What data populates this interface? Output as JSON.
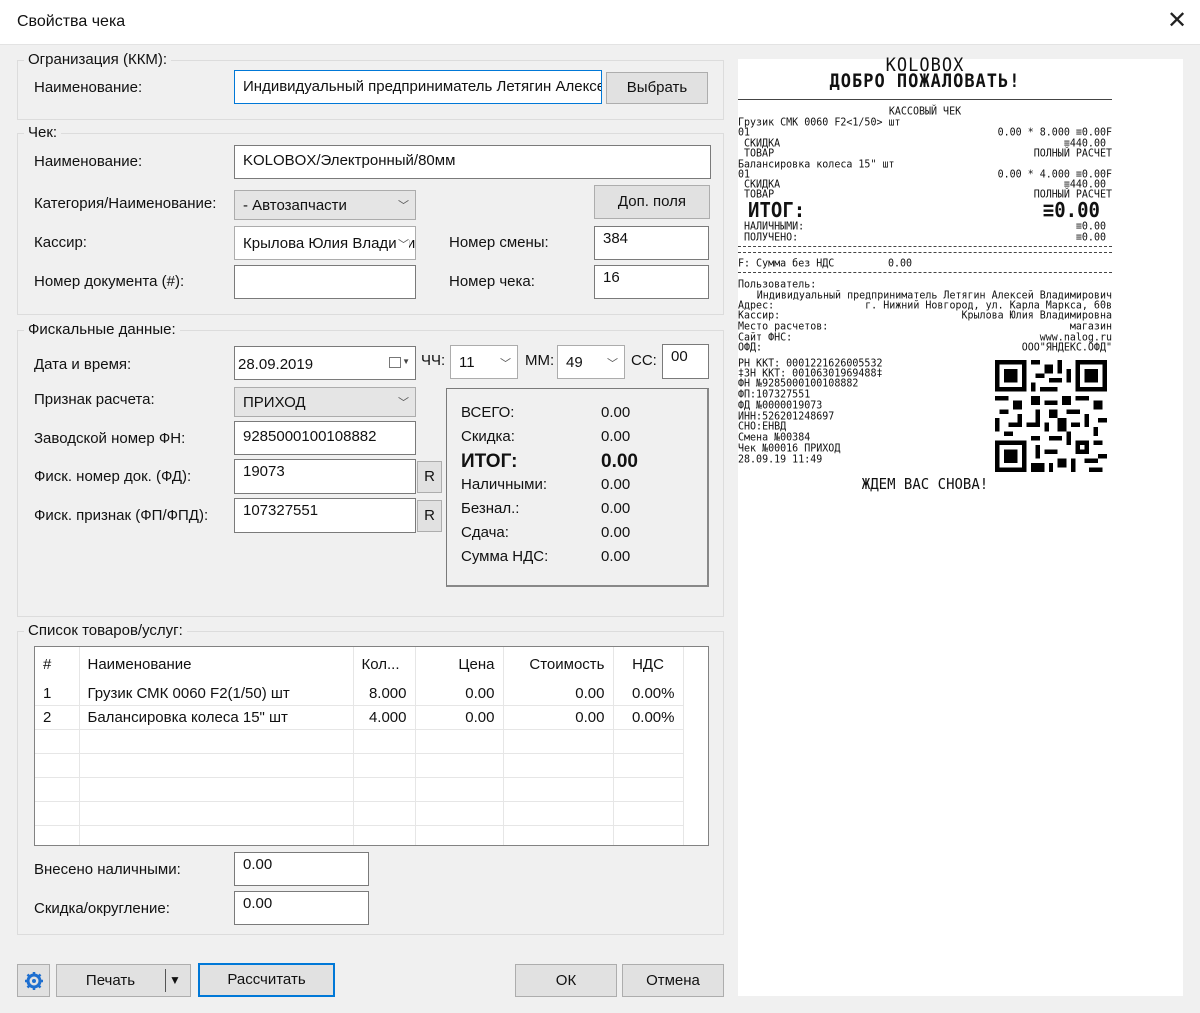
{
  "window": {
    "title": "Свойства чека",
    "close_glyph": "✕"
  },
  "org": {
    "legend": "Огранизация (ККМ):",
    "name_label": "Наименование:",
    "name_value": "Индивидуальный предприниматель Летягин Алексей Владимирович",
    "select_button": "Выбрать"
  },
  "check": {
    "legend": "Чек:",
    "name_label": "Наименование:",
    "name_value": "KOLOBOX/Электронный/80мм",
    "category_label": "Категория/Наименование:",
    "category_value": "- Автозапчасти",
    "extra_fields_button": "Доп. поля",
    "cashier_label": "Кассир:",
    "cashier_value": "Крылова Юлия Владимировна",
    "shift_label": "Номер смены:",
    "shift_value": "384",
    "doc_label": "Номер документа (#):",
    "doc_value": "",
    "check_no_label": "Номер чека:",
    "check_no_value": "16"
  },
  "fiscal": {
    "legend": "Фискальные данные:",
    "datetime_label": "Дата и время:",
    "date_value": "28.09.2019",
    "hh_label": "ЧЧ:",
    "hh_value": "11",
    "mm_label": "ММ:",
    "mm_value": "49",
    "ss_label": "СС:",
    "ss_value": "00",
    "calc_sign_label": "Признак расчета:",
    "calc_sign_value": "ПРИХОД",
    "fn_label": "Заводской номер ФН:",
    "fn_value": "9285000100108882",
    "fd_label": "Фиск. номер док. (ФД):",
    "fd_value": "19073",
    "fp_label": "Фиск. признак (ФП/ФПД):",
    "fp_value": "107327551",
    "r_button": "R"
  },
  "summary": {
    "total_label": "ВСЕГО:",
    "total_value": "0.00",
    "discount_label": "Скидка:",
    "discount_value": "0.00",
    "itog_label": "ИТОГ:",
    "itog_value": "0.00",
    "cash_label": "Наличными:",
    "cash_value": "0.00",
    "cashless_label": "Безнал.:",
    "cashless_value": "0.00",
    "change_label": "Сдача:",
    "change_value": "0.00",
    "vat_label": "Сумма НДС:",
    "vat_value": "0.00"
  },
  "goods": {
    "legend": "Список товаров/услуг:",
    "columns": [
      "#",
      "Наименование",
      "Кол...",
      "Цена",
      "Стоимость",
      "НДС"
    ],
    "rows": [
      [
        "1",
        "Грузик СМК 0060 F2(1/50) шт",
        "8.000",
        "0.00",
        "0.00",
        "0.00%"
      ],
      [
        "2",
        "Балансировка колеса 15\" шт",
        "4.000",
        "0.00",
        "0.00",
        "0.00%"
      ]
    ],
    "cash_in_label": "Внесено наличными:",
    "cash_in_value": "0.00",
    "rounding_label": "Скидка/округление:",
    "rounding_value": "0.00"
  },
  "footer": {
    "print_button": "Печать",
    "calculate_button": "Рассчитать",
    "ok_button": "ОК",
    "cancel_button": "Отмена"
  },
  "receipt": {
    "brand": "KOLOBOX",
    "welcome": "ДОБРО ПОЖАЛОВАТЬ!",
    "doc_type": "КАССОВЫЙ ЧЕК",
    "item1_name": "Грузик СМК 0060 F2<1/50> шт",
    "item1_code": "01",
    "item1_calc": "0.00 * 8.000 ≡0.00F",
    "item1_discount_label": "СКИДКА",
    "item1_discount_value": "≡440.00",
    "item1_type": "ТОВАР",
    "item1_mode": "ПОЛНЫЙ РАСЧЕТ",
    "item2_name": "Балансировка колеса 15\" шт",
    "item2_code": "01",
    "item2_calc": "0.00 * 4.000 ≡0.00F",
    "item2_discount_label": "СКИДКА",
    "item2_discount_value": "≡440.00",
    "item2_type": "ТОВАР",
    "item2_mode": "ПОЛНЫЙ РАСЧЕТ",
    "itog_label": "ИТОГ:",
    "itog_value": "≡0.00",
    "cash_label": "НАЛИЧНЫМИ:",
    "cash_value": "≡0.00",
    "received_label": "ПОЛУЧЕНО:",
    "received_value": "≡0.00",
    "vat_line_label": "F: Сумма без НДС",
    "vat_line_value": "0.00",
    "user_label": "Пользователь:",
    "user_value": "Индивидуальный предприниматель Летягин Алексей Владимирович",
    "address_label": "Адрес:",
    "address_value": "г. Нижний Новгород, ул. Карла Маркса, 60в",
    "cashier_label": "Кассир:",
    "cashier_value": "Крылова Юлия Владимировна",
    "place_label": "Место расчетов:",
    "place_value": "магазин",
    "fns_label": "Сайт ФНС:",
    "fns_value": "www.nalog.ru",
    "ofd_label": "ОФД:",
    "ofd_value": "ООО\"ЯНДЕКС.ОФД\"",
    "fiscal_lines": [
      "РН ККТ: 0001221626005532",
      "‡ЗН ККТ: 00106301969488‡",
      "ФН №9285000100108882",
      "ФП:107327551",
      "ФД №0000019073",
      "ИНН:526201248697",
      "СНО:ЕНВД",
      "Смена №00384",
      "Чек №00016 ПРИХОД",
      "28.09.19 11:49"
    ],
    "goodbye": "ЖДЕМ ВАС СНОВА!"
  }
}
